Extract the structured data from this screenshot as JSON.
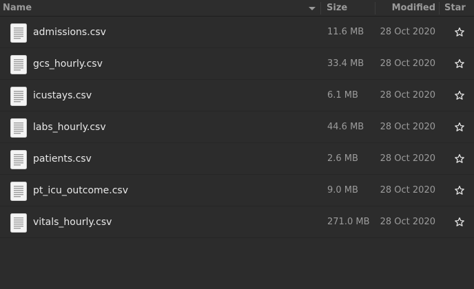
{
  "header": {
    "name_label": "Name",
    "size_label": "Size",
    "modified_label": "Modified",
    "star_label": "Star",
    "sort_indicator": "chevron-down-icon"
  },
  "files": [
    {
      "name": "admissions.csv",
      "size": "11.6 MB",
      "modified": "28 Oct 2020",
      "icon": "text-file-icon",
      "starred": false
    },
    {
      "name": "gcs_hourly.csv",
      "size": "33.4 MB",
      "modified": "28 Oct 2020",
      "icon": "text-file-icon",
      "starred": false
    },
    {
      "name": "icustays.csv",
      "size": "6.1 MB",
      "modified": "28 Oct 2020",
      "icon": "text-file-icon",
      "starred": false
    },
    {
      "name": "labs_hourly.csv",
      "size": "44.6 MB",
      "modified": "28 Oct 2020",
      "icon": "text-file-icon",
      "starred": false
    },
    {
      "name": "patients.csv",
      "size": "2.6 MB",
      "modified": "28 Oct 2020",
      "icon": "text-file-icon",
      "starred": false
    },
    {
      "name": "pt_icu_outcome.csv",
      "size": "9.0 MB",
      "modified": "28 Oct 2020",
      "icon": "text-file-icon",
      "starred": false
    },
    {
      "name": "vitals_hourly.csv",
      "size": "271.0 MB",
      "modified": "28 Oct 2020",
      "icon": "text-file-icon",
      "starred": false
    }
  ],
  "colors": {
    "background": "#2c2c2c",
    "header_text": "#9a9a9a",
    "filename_text": "#e8e8e8",
    "meta_text": "#9c9c9c"
  }
}
